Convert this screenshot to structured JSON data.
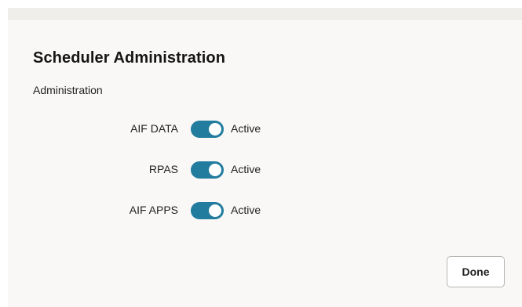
{
  "dialog": {
    "title": "Scheduler Administration",
    "section_label": "Administration",
    "toggles": [
      {
        "label": "AIF DATA",
        "state_label": "Active",
        "on": true
      },
      {
        "label": "RPAS",
        "state_label": "Active",
        "on": true
      },
      {
        "label": "AIF APPS",
        "state_label": "Active",
        "on": true
      }
    ],
    "done_label": "Done"
  },
  "colors": {
    "switch_on": "#227c9e",
    "dialog_background": "#f9f8f6"
  },
  "icons": {
    "switch_knob": "toggle-knob-icon"
  }
}
